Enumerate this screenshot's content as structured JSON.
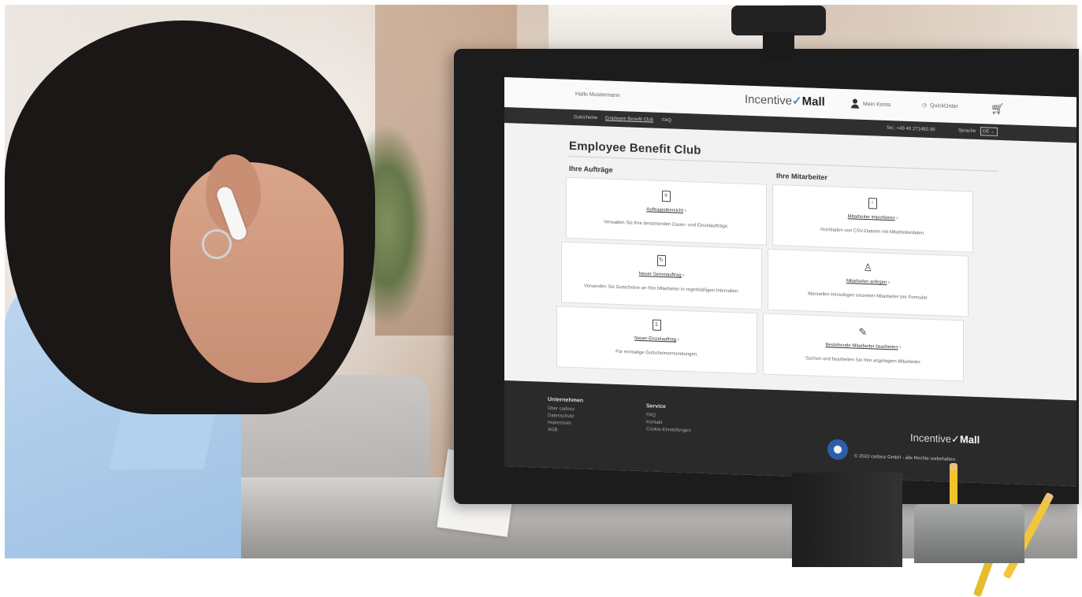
{
  "site": {
    "greeting": "Hallo Mustermann",
    "logo_text_a": "Incentive",
    "logo_text_b": "Mall",
    "logo_check": "✓",
    "account_label": "Mein Konto",
    "quickorder_label": "QuickOrder",
    "cart_icon": "cart-icon"
  },
  "nav": {
    "items": [
      "Gutscheine",
      "Employee Benefit Club",
      "FAQ"
    ],
    "phone": "Tel.: +49 40 271482-30",
    "language_label": "Sprache",
    "language_value": "DE ⌄"
  },
  "page": {
    "title": "Employee Benefit Club",
    "section_left": "Ihre Aufträge",
    "section_right": "Ihre Mitarbeiter"
  },
  "cards": [
    {
      "link": "Auftragsübersicht",
      "desc": "Verwalten Sie Ihre bestehenden Dauer- und Einzelaufträge.",
      "icon": "document-icon",
      "glyph": "≡"
    },
    {
      "link": "Mitarbeiter importieren",
      "desc": "Hochladen von CSV-Dateien mit Mitarbeiterdaten.",
      "icon": "upload-document-icon",
      "glyph": "↑"
    },
    {
      "link": "Neuer Serienauftrag",
      "desc": "Versenden Sie Gutscheine an Ihre Mitarbeiter in regelmäßigen Intervallen.",
      "icon": "recurring-document-icon",
      "glyph": "↻"
    },
    {
      "link": "Mitarbeiter anlegen",
      "desc": "Manuelles Hinzufügen einzelner Mitarbeiter per Formular.",
      "icon": "add-user-icon",
      "glyph": "♙"
    },
    {
      "link": "Neuer Einzelauftrag",
      "desc": "Für einmalige Gutscheinversendungen.",
      "icon": "single-document-icon",
      "glyph": "1"
    },
    {
      "link": "Bestehende Mitarbeiter bearbeiten",
      "desc": "Suchen und bearbeiten Sie Ihre angelegten Mitarbeiter.",
      "icon": "edit-user-icon",
      "glyph": "✎"
    }
  ],
  "footer": {
    "col1_heading": "Unternehmen",
    "col1_links": [
      "Über cadooz",
      "Datenschutz",
      "Impressum",
      "AGB"
    ],
    "col2_heading": "Service",
    "col2_links": [
      "FAQ",
      "Kontakt",
      "Cookie-Einstellungen"
    ],
    "logo_a": "Incentive",
    "logo_b": "Mall",
    "copyright": "© 2022 cadooz GmbH - alle Rechte vorbehalten."
  }
}
